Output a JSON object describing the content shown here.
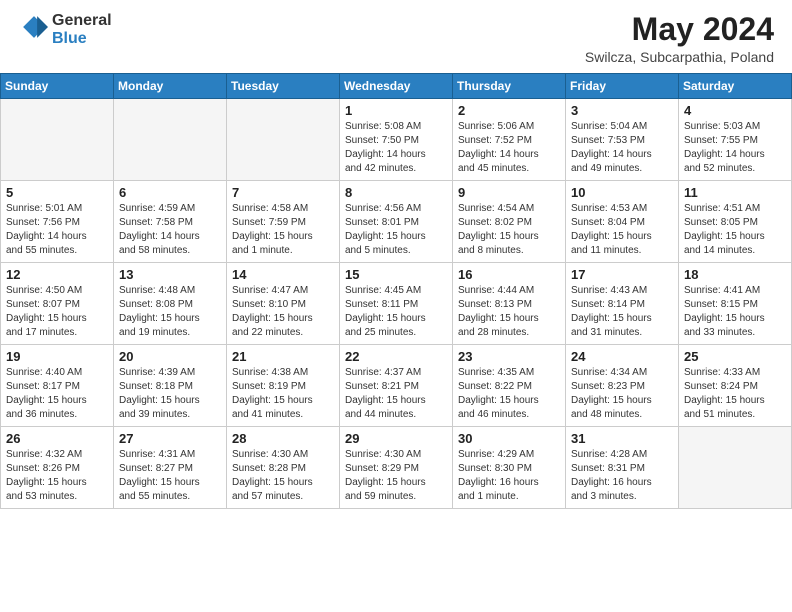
{
  "header": {
    "logo_general": "General",
    "logo_blue": "Blue",
    "month_title": "May 2024",
    "location": "Swilcza, Subcarpathia, Poland"
  },
  "weekdays": [
    "Sunday",
    "Monday",
    "Tuesday",
    "Wednesday",
    "Thursday",
    "Friday",
    "Saturday"
  ],
  "weeks": [
    [
      {
        "day": "",
        "info": ""
      },
      {
        "day": "",
        "info": ""
      },
      {
        "day": "",
        "info": ""
      },
      {
        "day": "1",
        "info": "Sunrise: 5:08 AM\nSunset: 7:50 PM\nDaylight: 14 hours\nand 42 minutes."
      },
      {
        "day": "2",
        "info": "Sunrise: 5:06 AM\nSunset: 7:52 PM\nDaylight: 14 hours\nand 45 minutes."
      },
      {
        "day": "3",
        "info": "Sunrise: 5:04 AM\nSunset: 7:53 PM\nDaylight: 14 hours\nand 49 minutes."
      },
      {
        "day": "4",
        "info": "Sunrise: 5:03 AM\nSunset: 7:55 PM\nDaylight: 14 hours\nand 52 minutes."
      }
    ],
    [
      {
        "day": "5",
        "info": "Sunrise: 5:01 AM\nSunset: 7:56 PM\nDaylight: 14 hours\nand 55 minutes."
      },
      {
        "day": "6",
        "info": "Sunrise: 4:59 AM\nSunset: 7:58 PM\nDaylight: 14 hours\nand 58 minutes."
      },
      {
        "day": "7",
        "info": "Sunrise: 4:58 AM\nSunset: 7:59 PM\nDaylight: 15 hours\nand 1 minute."
      },
      {
        "day": "8",
        "info": "Sunrise: 4:56 AM\nSunset: 8:01 PM\nDaylight: 15 hours\nand 5 minutes."
      },
      {
        "day": "9",
        "info": "Sunrise: 4:54 AM\nSunset: 8:02 PM\nDaylight: 15 hours\nand 8 minutes."
      },
      {
        "day": "10",
        "info": "Sunrise: 4:53 AM\nSunset: 8:04 PM\nDaylight: 15 hours\nand 11 minutes."
      },
      {
        "day": "11",
        "info": "Sunrise: 4:51 AM\nSunset: 8:05 PM\nDaylight: 15 hours\nand 14 minutes."
      }
    ],
    [
      {
        "day": "12",
        "info": "Sunrise: 4:50 AM\nSunset: 8:07 PM\nDaylight: 15 hours\nand 17 minutes."
      },
      {
        "day": "13",
        "info": "Sunrise: 4:48 AM\nSunset: 8:08 PM\nDaylight: 15 hours\nand 19 minutes."
      },
      {
        "day": "14",
        "info": "Sunrise: 4:47 AM\nSunset: 8:10 PM\nDaylight: 15 hours\nand 22 minutes."
      },
      {
        "day": "15",
        "info": "Sunrise: 4:45 AM\nSunset: 8:11 PM\nDaylight: 15 hours\nand 25 minutes."
      },
      {
        "day": "16",
        "info": "Sunrise: 4:44 AM\nSunset: 8:13 PM\nDaylight: 15 hours\nand 28 minutes."
      },
      {
        "day": "17",
        "info": "Sunrise: 4:43 AM\nSunset: 8:14 PM\nDaylight: 15 hours\nand 31 minutes."
      },
      {
        "day": "18",
        "info": "Sunrise: 4:41 AM\nSunset: 8:15 PM\nDaylight: 15 hours\nand 33 minutes."
      }
    ],
    [
      {
        "day": "19",
        "info": "Sunrise: 4:40 AM\nSunset: 8:17 PM\nDaylight: 15 hours\nand 36 minutes."
      },
      {
        "day": "20",
        "info": "Sunrise: 4:39 AM\nSunset: 8:18 PM\nDaylight: 15 hours\nand 39 minutes."
      },
      {
        "day": "21",
        "info": "Sunrise: 4:38 AM\nSunset: 8:19 PM\nDaylight: 15 hours\nand 41 minutes."
      },
      {
        "day": "22",
        "info": "Sunrise: 4:37 AM\nSunset: 8:21 PM\nDaylight: 15 hours\nand 44 minutes."
      },
      {
        "day": "23",
        "info": "Sunrise: 4:35 AM\nSunset: 8:22 PM\nDaylight: 15 hours\nand 46 minutes."
      },
      {
        "day": "24",
        "info": "Sunrise: 4:34 AM\nSunset: 8:23 PM\nDaylight: 15 hours\nand 48 minutes."
      },
      {
        "day": "25",
        "info": "Sunrise: 4:33 AM\nSunset: 8:24 PM\nDaylight: 15 hours\nand 51 minutes."
      }
    ],
    [
      {
        "day": "26",
        "info": "Sunrise: 4:32 AM\nSunset: 8:26 PM\nDaylight: 15 hours\nand 53 minutes."
      },
      {
        "day": "27",
        "info": "Sunrise: 4:31 AM\nSunset: 8:27 PM\nDaylight: 15 hours\nand 55 minutes."
      },
      {
        "day": "28",
        "info": "Sunrise: 4:30 AM\nSunset: 8:28 PM\nDaylight: 15 hours\nand 57 minutes."
      },
      {
        "day": "29",
        "info": "Sunrise: 4:30 AM\nSunset: 8:29 PM\nDaylight: 15 hours\nand 59 minutes."
      },
      {
        "day": "30",
        "info": "Sunrise: 4:29 AM\nSunset: 8:30 PM\nDaylight: 16 hours\nand 1 minute."
      },
      {
        "day": "31",
        "info": "Sunrise: 4:28 AM\nSunset: 8:31 PM\nDaylight: 16 hours\nand 3 minutes."
      },
      {
        "day": "",
        "info": ""
      }
    ]
  ]
}
